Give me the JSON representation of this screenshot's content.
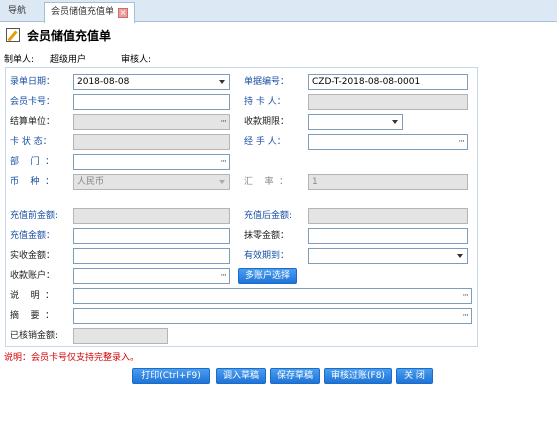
{
  "tabs": {
    "nav": "导航",
    "active": "会员储值充值单",
    "close": "×"
  },
  "page_title": "会员储值充值单",
  "meta": {
    "creator_label": "制单人:",
    "creator_value": "超级用户",
    "reviewer_label": "审核人:"
  },
  "form": {
    "entry_date": {
      "label": "录单日期：",
      "value": "2018-08-08"
    },
    "doc_no": {
      "label": "单据编号：",
      "value": "CZD-T-2018-08-08-0001"
    },
    "member_card": {
      "label": "会员卡号：",
      "value": ""
    },
    "card_holder": {
      "label": "持 卡 人：",
      "value": ""
    },
    "settle_unit": {
      "label": "结算单位：",
      "value": ""
    },
    "payment_term": {
      "label": "收款期限：",
      "value": ""
    },
    "card_status": {
      "label": "卡 状 态：",
      "value": ""
    },
    "handler": {
      "label": "经 手 人：",
      "value": ""
    },
    "department": {
      "label": "部    门  ：",
      "value": ""
    },
    "currency": {
      "label": "币    种  ：",
      "value": "人民币"
    },
    "exchange_rate": {
      "label": "汇    率  ：",
      "value": "1"
    },
    "balance_before": {
      "label": "充值前金额:",
      "value": ""
    },
    "balance_after": {
      "label": "充值后金额:",
      "value": ""
    },
    "recharge_amount": {
      "label": "充值金额：",
      "value": ""
    },
    "rounding_amount": {
      "label": "抹零金额：",
      "value": ""
    },
    "received_amount": {
      "label": "实收金额：",
      "value": ""
    },
    "valid_until": {
      "label": "有效期到：",
      "value": ""
    },
    "receipt_account": {
      "label": "收款账户：",
      "value": ""
    },
    "multi_account_btn": "多账户选择",
    "description": {
      "label": "说    明  ：",
      "value": ""
    },
    "summary": {
      "label": "摘    要  ：",
      "value": ""
    },
    "written_off": {
      "label": "已核销金额:",
      "value": ""
    }
  },
  "note": "说明：会员卡号仅支持完整录入。",
  "buttons": {
    "print": "打印(Ctrl+F9)",
    "load_draft": "调入草稿",
    "save_draft": "保存草稿",
    "approve": "审核过账(F8)",
    "close": "关 闭"
  },
  "icons": {
    "ellipsis": "···"
  }
}
